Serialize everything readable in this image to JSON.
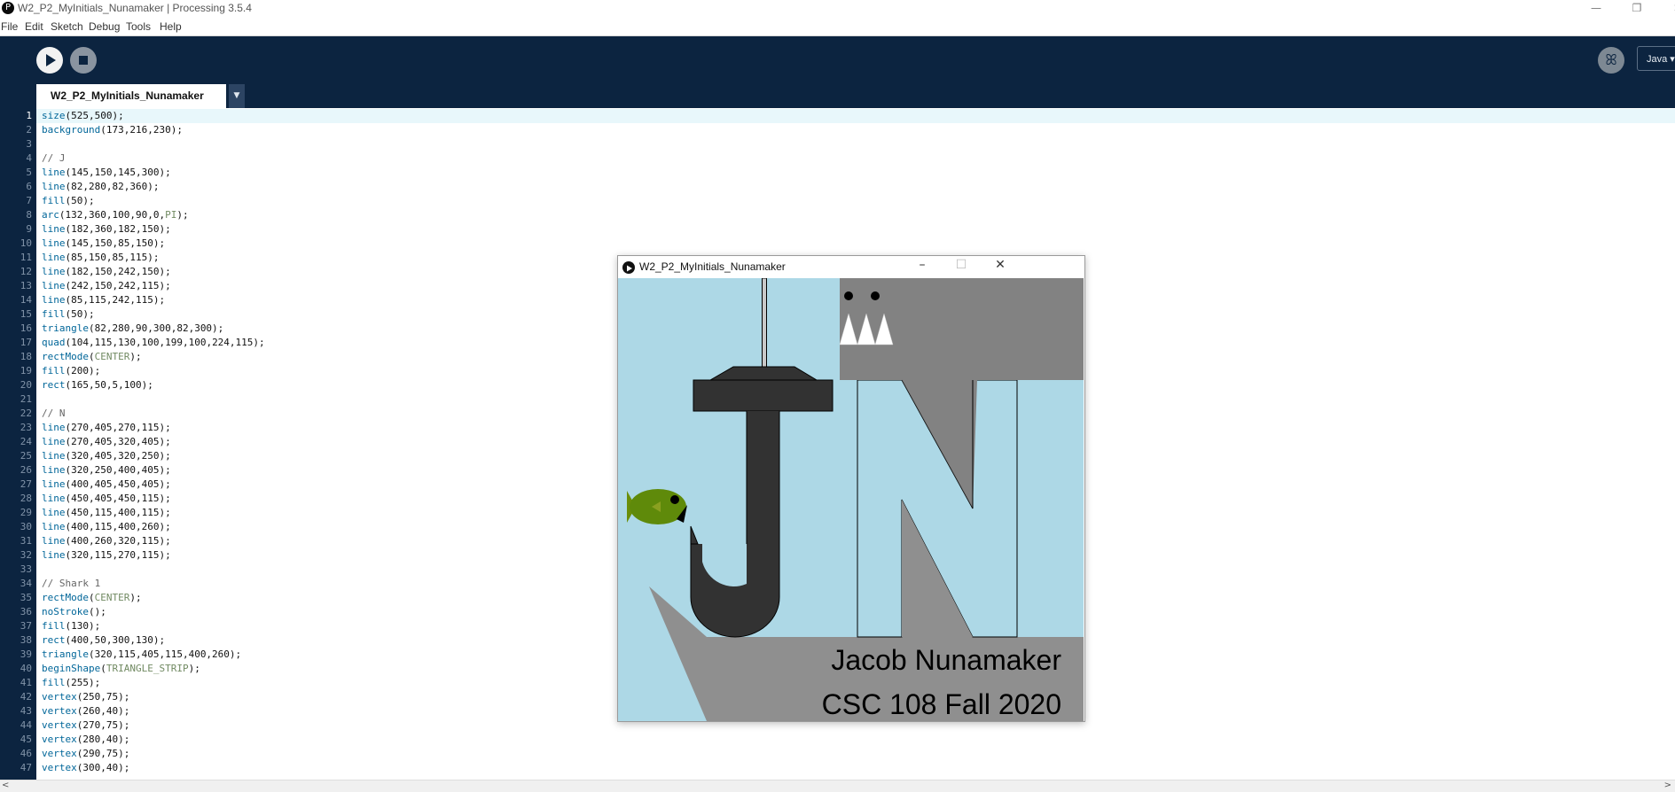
{
  "window": {
    "title": "W2_P2_MyInitials_Nunamaker | Processing 3.5.4",
    "minimize_glyph": "—",
    "restore_glyph": "❐",
    "close_glyph": "✕"
  },
  "menu": [
    "File",
    "Edit",
    "Sketch",
    "Debug",
    "Tools",
    "Help"
  ],
  "toolbar": {
    "mode_label": "Java ▾",
    "debug_glyph": "ꕤ"
  },
  "tabs": {
    "active": "W2_P2_MyInitials_Nunamaker",
    "menu_glyph": "▼"
  },
  "code_lines": [
    {
      "n": "1",
      "t": "size(525,500);"
    },
    {
      "n": "2",
      "t": "background(173,216,230);"
    },
    {
      "n": "3",
      "t": ""
    },
    {
      "n": "4",
      "t": "// J"
    },
    {
      "n": "5",
      "t": "line(145,150,145,300);"
    },
    {
      "n": "6",
      "t": "line(82,280,82,360);"
    },
    {
      "n": "7",
      "t": "fill(50);"
    },
    {
      "n": "8",
      "t": "arc(132,360,100,90,0,PI);"
    },
    {
      "n": "9",
      "t": "line(182,360,182,150);"
    },
    {
      "n": "10",
      "t": "line(145,150,85,150);"
    },
    {
      "n": "11",
      "t": "line(85,150,85,115);"
    },
    {
      "n": "12",
      "t": "line(182,150,242,150);"
    },
    {
      "n": "13",
      "t": "line(242,150,242,115);"
    },
    {
      "n": "14",
      "t": "line(85,115,242,115);"
    },
    {
      "n": "15",
      "t": "fill(50);"
    },
    {
      "n": "16",
      "t": "triangle(82,280,90,300,82,300);"
    },
    {
      "n": "17",
      "t": "quad(104,115,130,100,199,100,224,115);"
    },
    {
      "n": "18",
      "t": "rectMode(CENTER);"
    },
    {
      "n": "19",
      "t": "fill(200);"
    },
    {
      "n": "20",
      "t": "rect(165,50,5,100);"
    },
    {
      "n": "21",
      "t": ""
    },
    {
      "n": "22",
      "t": "// N"
    },
    {
      "n": "23",
      "t": "line(270,405,270,115);"
    },
    {
      "n": "24",
      "t": "line(270,405,320,405);"
    },
    {
      "n": "25",
      "t": "line(320,405,320,250);"
    },
    {
      "n": "26",
      "t": "line(320,250,400,405);"
    },
    {
      "n": "27",
      "t": "line(400,405,450,405);"
    },
    {
      "n": "28",
      "t": "line(450,405,450,115);"
    },
    {
      "n": "29",
      "t": "line(450,115,400,115);"
    },
    {
      "n": "30",
      "t": "line(400,115,400,260);"
    },
    {
      "n": "31",
      "t": "line(400,260,320,115);"
    },
    {
      "n": "32",
      "t": "line(320,115,270,115);"
    },
    {
      "n": "33",
      "t": ""
    },
    {
      "n": "34",
      "t": "// Shark 1"
    },
    {
      "n": "35",
      "t": "rectMode(CENTER);"
    },
    {
      "n": "36",
      "t": "noStroke();"
    },
    {
      "n": "37",
      "t": "fill(130);"
    },
    {
      "n": "38",
      "t": "rect(400,50,300,130);"
    },
    {
      "n": "39",
      "t": "triangle(320,115,405,115,400,260);"
    },
    {
      "n": "40",
      "t": "beginShape(TRIANGLE_STRIP);"
    },
    {
      "n": "41",
      "t": "fill(255);"
    },
    {
      "n": "42",
      "t": "vertex(250,75);"
    },
    {
      "n": "43",
      "t": "vertex(260,40);"
    },
    {
      "n": "44",
      "t": "vertex(270,75);"
    },
    {
      "n": "45",
      "t": "vertex(280,40);"
    },
    {
      "n": "46",
      "t": "vertex(290,75);"
    },
    {
      "n": "47",
      "t": "vertex(300,40);"
    }
  ],
  "sketch": {
    "title": "W2_P2_MyInitials_Nunamaker",
    "name_line": "Jacob Nunamaker",
    "course_line": "CSC 108 Fall 2020",
    "colors": {
      "background": "#add8e6",
      "shark": "#828282",
      "hook": "#323232",
      "fish": "#5f8a0a"
    }
  }
}
